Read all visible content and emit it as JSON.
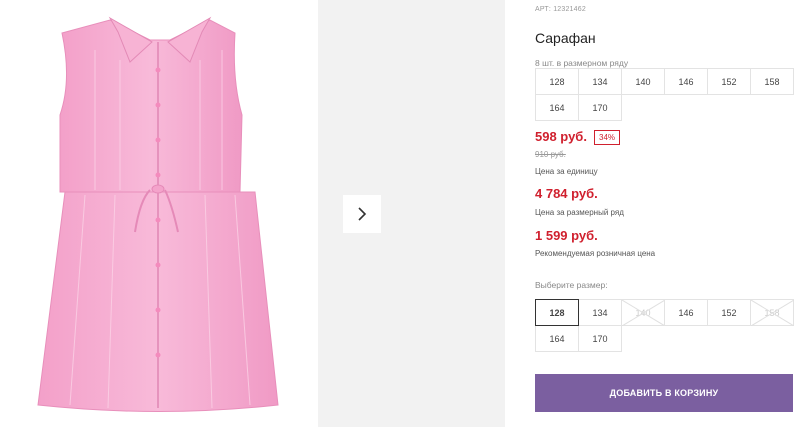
{
  "product": {
    "article": "АРТ: 12321462",
    "title": "Сарафан",
    "pack_note": "8 шт. в размерном ряду",
    "pack_sizes": [
      "128",
      "134",
      "140",
      "146",
      "152",
      "158",
      "164",
      "170"
    ],
    "price_sale": "598 руб.",
    "discount": "34%",
    "price_old": "910 руб.",
    "price_unit_label": "Цена за единицу",
    "price_set": "4 784 руб.",
    "price_set_label": "Цена за размерный ряд",
    "price_rrp": "1 599 руб.",
    "price_rrp_label": "Рекомендуемая розничная цена"
  },
  "size_picker": {
    "label": "Выберите размер:",
    "options": [
      {
        "label": "128",
        "state": "selected"
      },
      {
        "label": "134",
        "state": "available"
      },
      {
        "label": "140",
        "state": "disabled"
      },
      {
        "label": "146",
        "state": "available"
      },
      {
        "label": "152",
        "state": "available"
      },
      {
        "label": "158",
        "state": "disabled"
      },
      {
        "label": "164",
        "state": "available"
      },
      {
        "label": "170",
        "state": "available"
      }
    ]
  },
  "actions": {
    "add_to_cart": "ДОБАВИТЬ В КОРЗИНУ"
  },
  "colors": {
    "accent": "#7b5fa0",
    "price": "#d0202e",
    "dress": "#f4a9cf"
  },
  "icons": {
    "next": "chevron-right-icon"
  }
}
